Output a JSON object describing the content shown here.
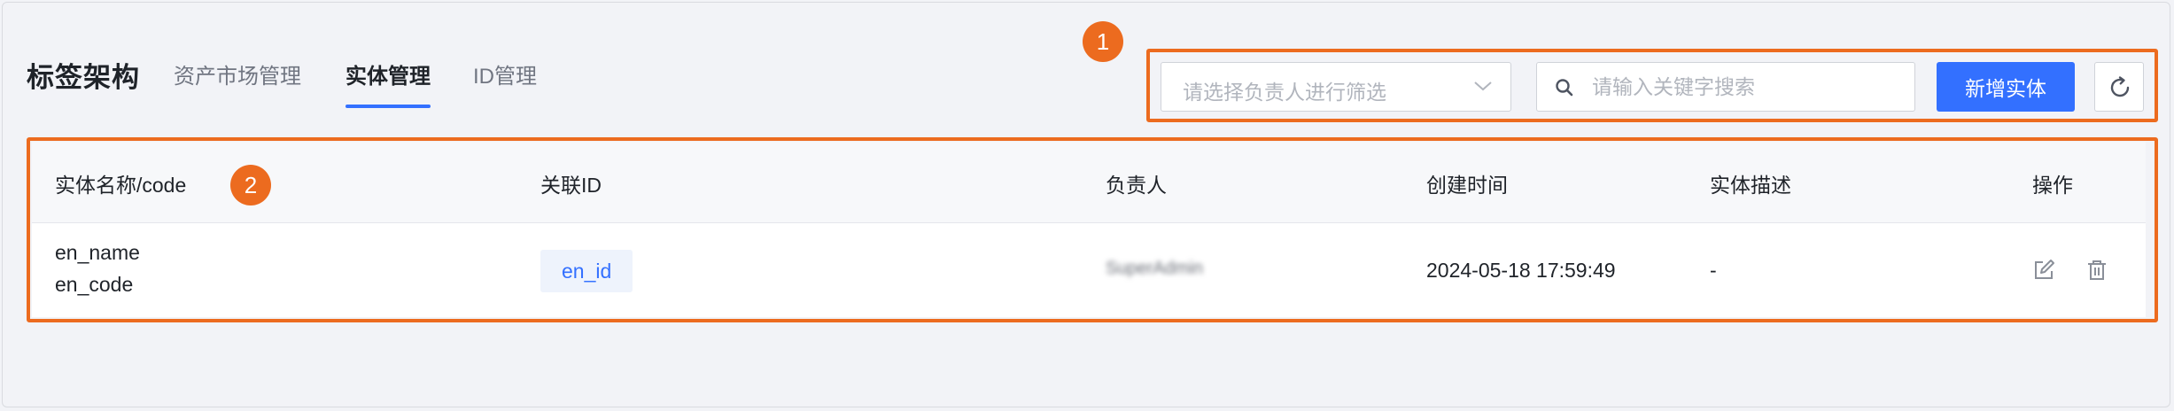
{
  "header": {
    "title": "标签架构",
    "tabs": [
      {
        "label": "资产市场管理",
        "active": false
      },
      {
        "label": "实体管理",
        "active": true
      },
      {
        "label": "ID管理",
        "active": false
      }
    ]
  },
  "callouts": [
    "1",
    "2"
  ],
  "toolbar": {
    "owner_filter_placeholder": "请选择负责人进行筛选",
    "search_placeholder": "请输入关键字搜索",
    "add_button_label": "新增实体"
  },
  "table": {
    "columns": [
      "实体名称/code",
      "关联ID",
      "负责人",
      "创建时间",
      "实体描述",
      "操作"
    ],
    "rows": [
      {
        "name": "en_name",
        "code": "en_code",
        "id": "en_id",
        "owner": "SuperAdmin",
        "created_at": "2024-05-18 17:59:49",
        "description": "-"
      }
    ]
  },
  "colors": {
    "primary": "#3370ff",
    "callout": "#ec6b1f",
    "background": "#f2f3f7"
  },
  "icons": [
    "chevron-down-icon",
    "search-icon",
    "refresh-icon",
    "edit-icon",
    "delete-icon"
  ]
}
